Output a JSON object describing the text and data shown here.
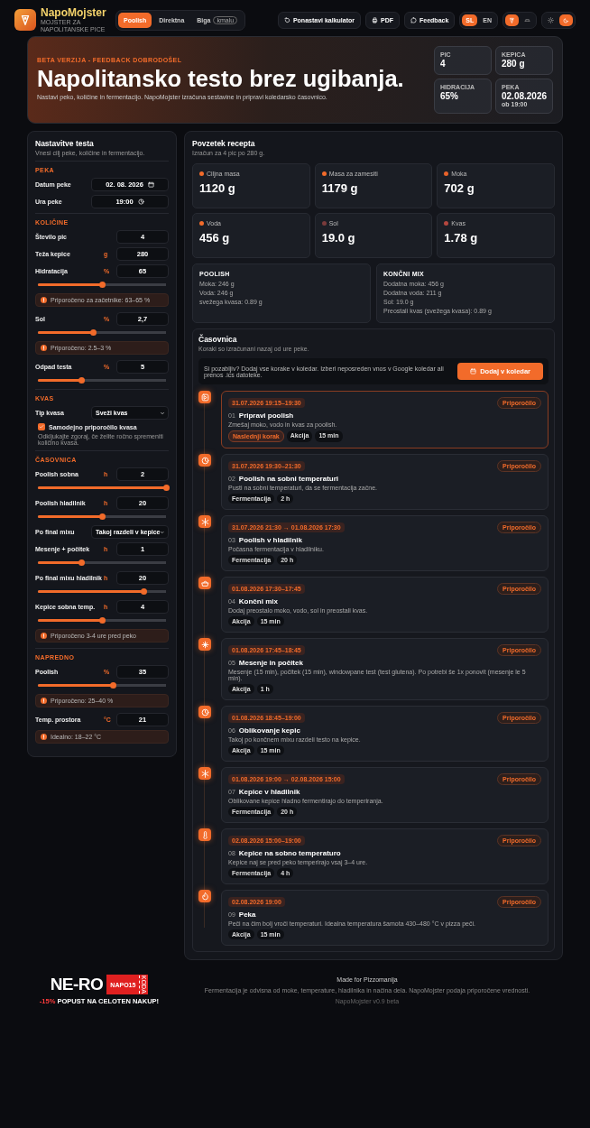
{
  "header": {
    "logo": {
      "title": "NapoMojster",
      "subtitle": "MOJSTER ZA NAPOLITANSKE PICE"
    },
    "method_tabs": [
      {
        "label": "Poolish",
        "selected": true
      },
      {
        "label": "Direktna",
        "selected": false
      },
      {
        "label": "Biga",
        "badge": "kmalu",
        "selected": false
      }
    ],
    "buttons": [
      "Ponastavi kalkulator",
      "PDF",
      "Feedback"
    ],
    "languages": [
      {
        "label": "SL",
        "selected": true
      },
      {
        "label": "EN",
        "selected": false
      }
    ],
    "mode_toggle": [
      {
        "selected": true
      },
      {
        "selected": false
      }
    ],
    "theme_toggle": [
      {
        "selected": false
      },
      {
        "selected": true
      }
    ]
  },
  "hero": {
    "eyebrow": "BETA VERZIJA - FEEDBACK DOBRODOŠEL",
    "title": "Napolitansko testo brez ugibanja.",
    "text": "Nastavi peko, količine in fermentacijo. NapoMojster izračuna sestavine in pripravi koledarsko časovnico.",
    "stats": [
      {
        "label": "PIC",
        "value": "4"
      },
      {
        "label": "KEPICA",
        "value": "280 g"
      },
      {
        "label": "HIDRACIJA",
        "value": "65%"
      },
      {
        "label": "PEKA",
        "value": "02.08.2026",
        "note": "ob 19:00"
      }
    ]
  },
  "settings": {
    "title": "Nastavitve testa",
    "subtitle": "Vnesi cilj peke, količine in fermentacijo.",
    "sections": [
      {
        "heading": "PEKA",
        "items": [
          {
            "kind": "date",
            "label": "Datum peke",
            "value": "02. 08. 2026"
          },
          {
            "kind": "time",
            "label": "Ura peke",
            "value": "19:00"
          }
        ]
      },
      {
        "heading": "KOLIČINE",
        "items": [
          {
            "kind": "number",
            "label": "Število pic",
            "value": "4"
          },
          {
            "kind": "number",
            "label": "Teža kepice",
            "unit": "g",
            "value": "280"
          },
          {
            "kind": "number",
            "label": "Hidratacija",
            "unit": "%",
            "value": "65",
            "level": 0.5
          },
          {
            "kind": "hint",
            "text": "Priporočeno za začetnike: 63–65 %"
          },
          {
            "kind": "number",
            "label": "Sol",
            "unit": "%",
            "value": "2,7",
            "level": 0.43
          },
          {
            "kind": "hint",
            "text": "Priporočeno: 2.5–3 %"
          },
          {
            "kind": "number",
            "label": "Odpad testa",
            "unit": "%",
            "value": "5",
            "level": 0.34
          }
        ]
      },
      {
        "heading": "KVAS",
        "items": [
          {
            "kind": "select",
            "label": "Tip kvasa",
            "value": "Sveži kvas"
          },
          {
            "kind": "checkbox",
            "label": "Samodejno priporočilo kvasa",
            "checked": true
          },
          {
            "kind": "note",
            "text": "Odkljukajte zgoraj, če želite ročno spremeniti količino kvasa."
          }
        ]
      },
      {
        "heading": "ČASOVNICA",
        "items": [
          {
            "kind": "number",
            "label": "Poolish sobna",
            "unit": "h",
            "value": "2",
            "level": 1
          },
          {
            "kind": "number",
            "label": "Poolish hladilnik",
            "unit": "h",
            "value": "20",
            "level": 0.5
          },
          {
            "kind": "select",
            "label": "Po final mixu",
            "value": "Takoj razdeli v kepice"
          },
          {
            "kind": "number",
            "label": "Mesenje + počitek",
            "unit": "h",
            "value": "1",
            "level": 0.34
          },
          {
            "kind": "number",
            "label": "Po final mixu hladilnik",
            "unit": "h",
            "value": "20",
            "level": 0.83
          },
          {
            "kind": "number",
            "label": "Kepice sobna temp.",
            "unit": "h",
            "value": "4",
            "level": 0.5
          },
          {
            "kind": "hint",
            "text": "Priporočeno 3-4 ure pred peko"
          }
        ]
      },
      {
        "heading": "NAPREDNO",
        "items": [
          {
            "kind": "number",
            "label": "Poolish",
            "unit": "%",
            "value": "35",
            "level": 0.59
          },
          {
            "kind": "hint",
            "text": "Priporočeno: 25–40 %"
          },
          {
            "kind": "number",
            "label": "Temp. prostora",
            "unit": "°C",
            "value": "21"
          },
          {
            "kind": "hint",
            "text": "Idealno: 18–22 °C"
          }
        ]
      }
    ]
  },
  "summary": {
    "title": "Povzetek recepta",
    "subtitle": "Izračun za 4 pic po 280 g.",
    "metrics": [
      {
        "label": "Ciljna masa",
        "value": "1120 g",
        "color": "#f26b2a"
      },
      {
        "label": "Masa za zamesiti",
        "value": "1179 g",
        "color": "#f26b2a"
      },
      {
        "label": "Moka",
        "value": "702 g",
        "color": "#e8622a"
      },
      {
        "label": "Voda",
        "value": "456 g",
        "color": "#f26b2a"
      },
      {
        "label": "Sol",
        "value": "19.0 g",
        "color": "#7a3b3b"
      },
      {
        "label": "Kvas",
        "value": "1.78 g",
        "color": "#b5473f"
      }
    ],
    "mixes": [
      {
        "title": "POOLISH",
        "lines": [
          "Moka: 246 g",
          "Voda: 246 g",
          "svežega kvasa: 0.89 g"
        ]
      },
      {
        "title": "KONČNI MIX",
        "lines": [
          "Dodatna moka: 456 g",
          "Dodatna voda: 211 g",
          "Sol: 19.0 g",
          "Preostali kvas (svežega kvasa): 0.89 g"
        ]
      }
    ]
  },
  "timeline": {
    "title": "Časovnica",
    "subtitle": "Koraki so izračunani nazaj od ure peke.",
    "banner": {
      "text": "Si pozabljiv? Dodaj vse korake v koledar. Izberi neposreden vnos v Google koledar ali prenos .ics datoteke.",
      "button": "Dodaj v koledar"
    },
    "steps": [
      {
        "time": "31.07.2026 19:15–19:30",
        "badge": "Priporočilo",
        "number": "01",
        "title": "Pripravi poolish",
        "text": "Zmešaj moko, vodo in kvas za poolish.",
        "current": true,
        "tags": [
          {
            "label": "Naslednji korak",
            "kind": "next"
          },
          {
            "label": "Akcija",
            "kind": "plain"
          },
          {
            "label": "15 min",
            "kind": "plain"
          }
        ]
      },
      {
        "time": "31.07.2026 19:30–21:30",
        "badge": "Priporočilo",
        "number": "02",
        "title": "Poolish na sobni temperaturi",
        "text": "Pusti na sobni temperaturi, da se fermentacija začne.",
        "current": false,
        "tags": [
          {
            "label": "Fermentacija",
            "kind": "plain"
          },
          {
            "label": "2 h",
            "kind": "plain"
          }
        ]
      },
      {
        "time": "31.07.2026 21:30 → 01.08.2026 17:30",
        "badge": "Priporočilo",
        "number": "03",
        "title": "Poolish v hladilnik",
        "text": "Počasna fermentacija v hladilniku.",
        "current": false,
        "tags": [
          {
            "label": "Fermentacija",
            "kind": "plain"
          },
          {
            "label": "20 h",
            "kind": "plain"
          }
        ]
      },
      {
        "time": "01.08.2026 17:30–17:45",
        "badge": "Priporočilo",
        "number": "04",
        "title": "Končni mix",
        "text": "Dodaj preostalo moko, vodo, sol in preostali kvas.",
        "current": false,
        "tags": [
          {
            "label": "Akcija",
            "kind": "plain"
          },
          {
            "label": "15 min",
            "kind": "plain"
          }
        ]
      },
      {
        "time": "01.08.2026 17:45–18:45",
        "badge": "Priporočilo",
        "number": "05",
        "title": "Mesenje in počitek",
        "text": "Mesenje (15 min), počitek (15 min), windowpane test (test glutena). Po potrebi še 1x ponovit (mesenje le 5 min).",
        "current": false,
        "tags": [
          {
            "label": "Akcija",
            "kind": "plain"
          },
          {
            "label": "1 h",
            "kind": "plain"
          }
        ]
      },
      {
        "time": "01.08.2026 18:45–19:00",
        "badge": "Priporočilo",
        "number": "06",
        "title": "Oblikovanje kepic",
        "text": "Takoj po končnem mixu razdeli testo na kepice.",
        "current": false,
        "tags": [
          {
            "label": "Akcija",
            "kind": "plain"
          },
          {
            "label": "15 min",
            "kind": "plain"
          }
        ]
      },
      {
        "time": "01.08.2026 19:00 → 02.08.2026 15:00",
        "badge": "Priporočilo",
        "number": "07",
        "title": "Kepice v hladilnik",
        "text": "Oblikovane kepice hladno fermentirajo do temperiranja.",
        "current": false,
        "tags": [
          {
            "label": "Fermentacija",
            "kind": "plain"
          },
          {
            "label": "20 h",
            "kind": "plain"
          }
        ]
      },
      {
        "time": "02.08.2026 15:00–19:00",
        "badge": "Priporočilo",
        "number": "08",
        "title": "Kepice na sobno temperaturo",
        "text": "Kepice naj se pred peko temperirajo vsaj 3–4 ure.",
        "current": false,
        "tags": [
          {
            "label": "Fermentacija",
            "kind": "plain"
          },
          {
            "label": "4 h",
            "kind": "plain"
          }
        ]
      },
      {
        "time": "02.08.2026 19:00",
        "badge": "Priporočilo",
        "number": "09",
        "title": "Peka",
        "text": "Peči na čim bolj vroči temperaturi. Idealna temperatura šamota 430–480 °C v pizza peči.",
        "current": false,
        "tags": [
          {
            "label": "Akcija",
            "kind": "plain"
          },
          {
            "label": "15 min",
            "kind": "plain"
          }
        ]
      }
    ]
  },
  "footer": {
    "sponsor": {
      "logo": "NE-RO",
      "code": "NAPO15",
      "code_label": "KODA",
      "discount": "-15%",
      "promo": "POPUST NA CELOTEN NAKUP!"
    },
    "made_for": "Made for Pizzomanija",
    "disclaimer": "Fermentacija je odvisna od moke, temperature, hladilnika in načina dela. NapoMojster podaja priporočene vrednosti.",
    "version": "NapoMojster v0.9 beta"
  }
}
